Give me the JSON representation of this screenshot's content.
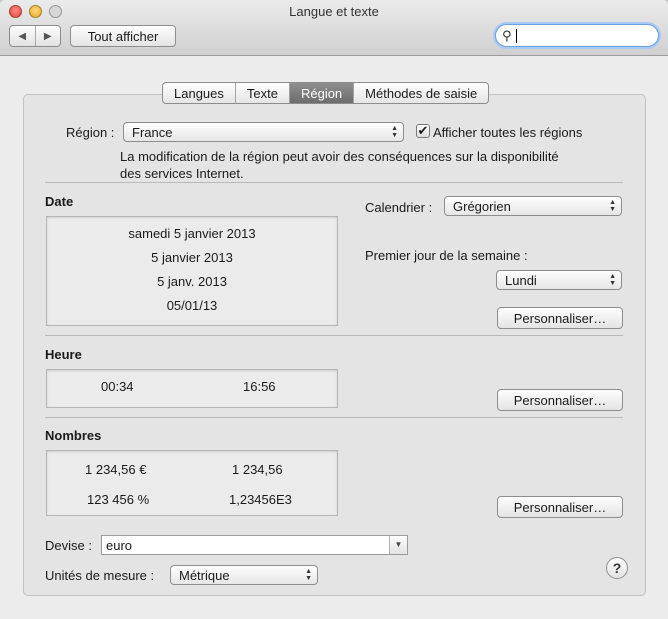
{
  "window": {
    "title": "Langue et texte"
  },
  "toolbar": {
    "back_glyph": "◀",
    "forward_glyph": "▶",
    "show_all": "Tout afficher",
    "search_value": "",
    "search_glyph": "⚲"
  },
  "tabs": [
    {
      "label": "Langues",
      "selected": false
    },
    {
      "label": "Texte",
      "selected": false
    },
    {
      "label": "Région",
      "selected": true
    },
    {
      "label": "Méthodes de saisie",
      "selected": false
    }
  ],
  "region": {
    "label": "Région :",
    "value": "France",
    "show_all_label": "Afficher toutes les régions",
    "show_all_checked": true,
    "check_glyph": "✔",
    "note_line1": "La modification de la région peut avoir des conséquences sur la disponibilité",
    "note_line2": "des services Internet."
  },
  "date": {
    "heading": "Date",
    "formats": [
      "samedi 5 janvier 2013",
      "5 janvier 2013",
      "5 janv. 2013",
      "05/01/13"
    ],
    "calendar_label": "Calendrier :",
    "calendar_value": "Grégorien",
    "first_day_label": "Premier jour de la semaine :",
    "first_day_value": "Lundi",
    "customize": "Personnaliser…"
  },
  "time": {
    "heading": "Heure",
    "short": "00:34",
    "long": "16:56",
    "customize": "Personnaliser…"
  },
  "numbers": {
    "heading": "Nombres",
    "currency": "1 234,56 €",
    "decimal": "1 234,56",
    "percent": "123 456 %",
    "scientific": "1,23456E3",
    "customize": "Personnaliser…"
  },
  "currency": {
    "label": "Devise :",
    "value": "euro"
  },
  "units": {
    "label": "Unités de mesure :",
    "value": "Métrique"
  },
  "help": {
    "glyph": "?"
  },
  "popup_arrows": "▲▼"
}
